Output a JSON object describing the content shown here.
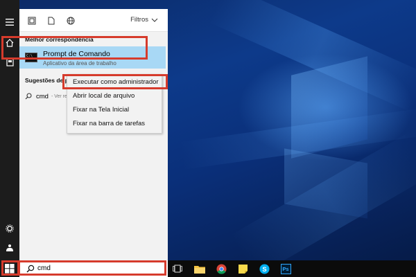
{
  "panel": {
    "filter_label": "Filtros",
    "best_match_header": "Melhor correspondência",
    "best_match": {
      "title": "Prompt de Comando",
      "subtitle": "Aplicativo da área de trabalho",
      "icon": "cmd-icon"
    },
    "suggestions_header": "Sugestões de p",
    "suggestion": {
      "text": "cmd",
      "sub": "- Ver re"
    }
  },
  "context_menu": {
    "items": [
      "Executar como administrador",
      "Abrir local de arquivo",
      "Fixar na Tela Inicial",
      "Fixar na barra de tarefas"
    ]
  },
  "search": {
    "value": "cmd"
  },
  "colors": {
    "highlight": "#a8d8f5",
    "outline": "#d63b2c",
    "taskbar": "#0b0b0b"
  },
  "taskbar_apps": [
    "task-view-icon",
    "file-explorer-icon",
    "chrome-icon",
    "sticky-notes-icon",
    "skype-icon",
    "photoshop-icon"
  ],
  "taskbar_labels": {
    "photoshop": "Ps"
  }
}
